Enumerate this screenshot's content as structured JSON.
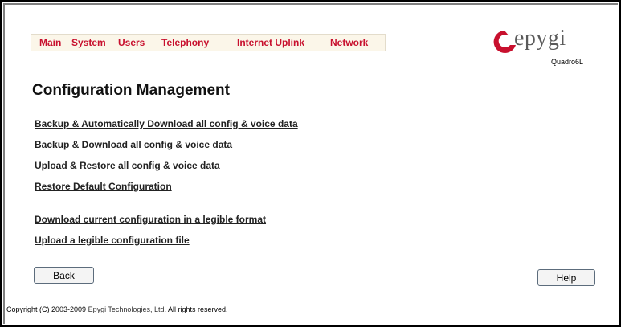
{
  "menu": {
    "items": [
      {
        "label": "Main"
      },
      {
        "label": "System"
      },
      {
        "label": "Users"
      },
      {
        "label": "Telephony"
      },
      {
        "label": "Internet Uplink"
      },
      {
        "label": "Network"
      }
    ]
  },
  "logo": {
    "text": "epygi",
    "model": "Quadro6L"
  },
  "page": {
    "title": "Configuration Management"
  },
  "links": [
    {
      "label": "Backup & Automatically Download all config & voice data"
    },
    {
      "label": "Backup & Download all config & voice data"
    },
    {
      "label": "Upload & Restore all config & voice data"
    },
    {
      "label": "Restore Default Configuration"
    },
    {
      "label": "Download current configuration in a legible format"
    },
    {
      "label": "Upload a legible configuration file"
    }
  ],
  "buttons": {
    "back": "Back",
    "help": "Help"
  },
  "footer": {
    "prefix": "Copyright (C) 2003-2009 ",
    "company": "Epygi Technologies, Ltd",
    "suffix": ". All rights reserved."
  },
  "colors": {
    "menu_text": "#c8102e",
    "menu_bg": "#fbf6e9",
    "logo_accent": "#c8102e"
  }
}
